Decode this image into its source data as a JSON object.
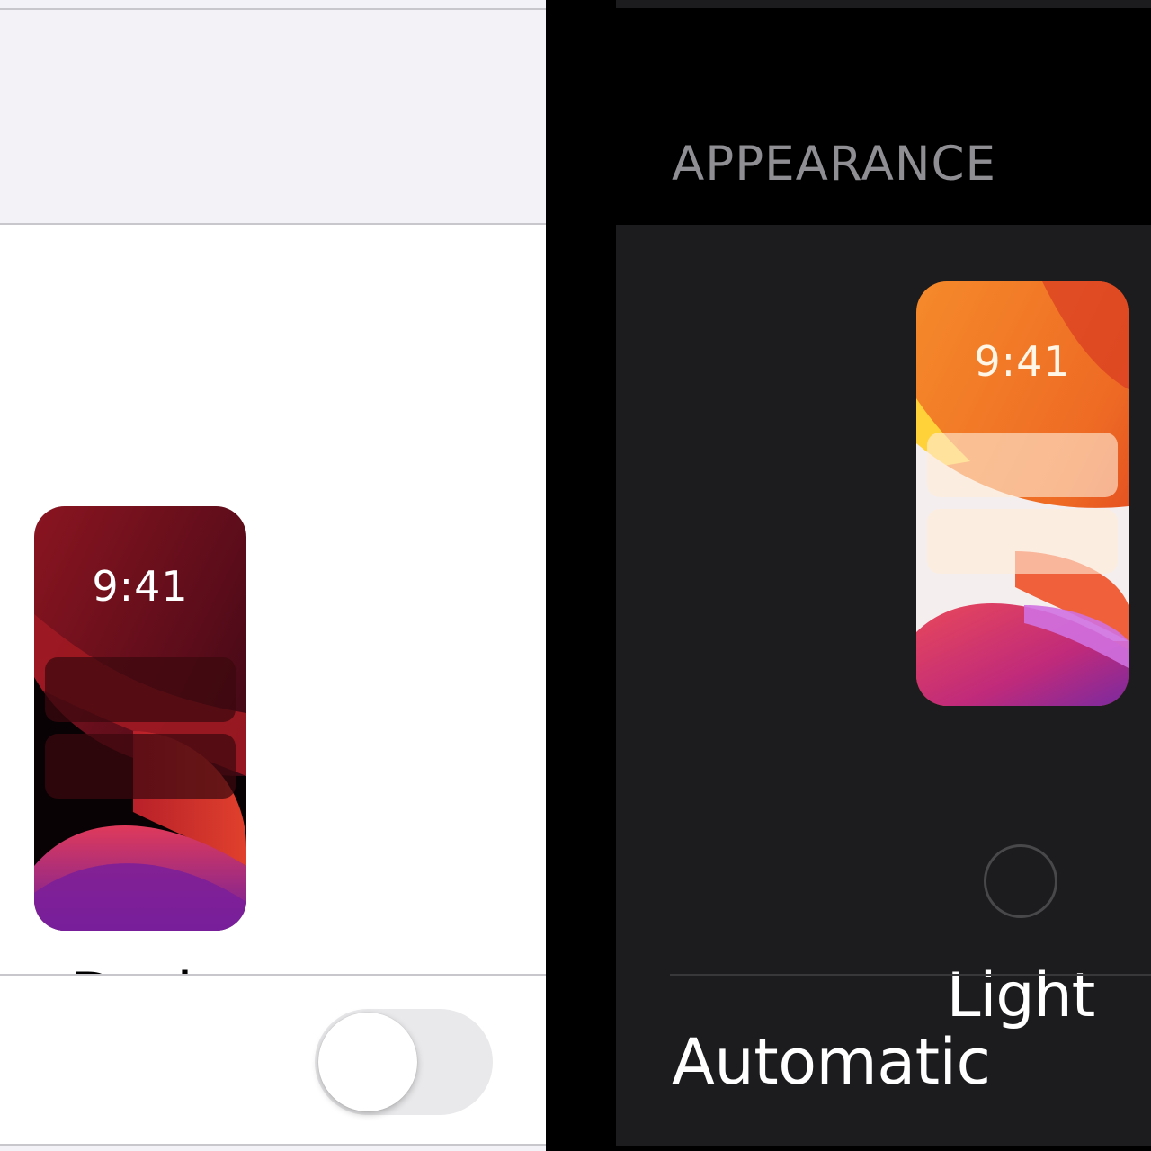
{
  "section": {
    "title": "APPEARANCE"
  },
  "options": {
    "dark": {
      "label": "Dark",
      "time": "9:41",
      "selected": false
    },
    "light": {
      "label": "Light",
      "time": "9:41",
      "selected": false
    }
  },
  "automatic": {
    "label": "Automatic",
    "enabled": false
  },
  "colors": {
    "light_background": "#f2f2f7",
    "light_card": "#ffffff",
    "dark_background": "#000000",
    "dark_card": "#1c1c1e",
    "secondary_text": "#8e8e93"
  }
}
